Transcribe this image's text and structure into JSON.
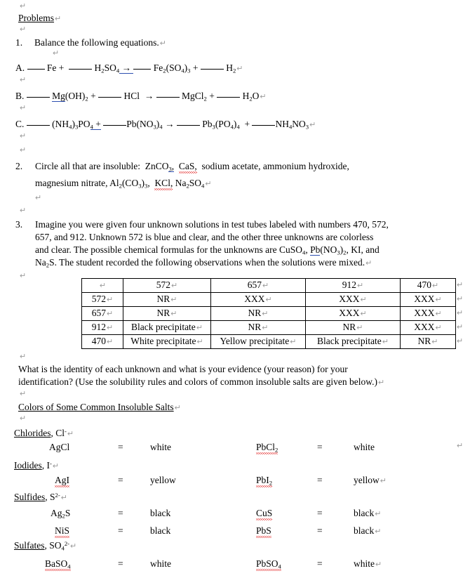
{
  "document": {
    "heading": "Problems",
    "pilcrow_glyph": "↵"
  },
  "q1": {
    "number": "1.",
    "prompt": "Balance the following equations.",
    "equations": [
      {
        "label": "A.",
        "parts": {
          "r1": "Fe",
          "plus1": "+",
          "r2_pre": "H",
          "r2": "H2SO4",
          "arrow": "→",
          "p1": "Fe2(SO4)3",
          "plus2": "+",
          "p2": "H2"
        }
      },
      {
        "label": "B.",
        "parts": {
          "r1": "Mg(OH)2",
          "plus1": "+",
          "r2": "HCl",
          "arrow": "→",
          "p1": "MgCl2",
          "plus2": "+",
          "p2": "H2O"
        }
      },
      {
        "label": "C.",
        "parts": {
          "r1": "(NH4)3PO4",
          "plus1": "+",
          "r2": "Pb(NO3)4",
          "arrow": "→",
          "p1": "Pb3(PO4)4",
          "plus2": "+",
          "p2": "NH4NO3"
        }
      }
    ]
  },
  "q2": {
    "number": "2.",
    "line1_lead": "Circle all that are insoluble:",
    "items_line1": [
      "ZnCO3,",
      "CaS,",
      "sodium acetate,",
      "ammonium hydroxide,"
    ],
    "items_line2": [
      "magnesium nitrate,",
      "Al2(CO3)3,",
      "KCl,",
      "Na2SO4"
    ]
  },
  "q3": {
    "number": "3.",
    "line1": "Imagine you were given four unknown solutions in test tubes labeled with numbers 470, 572,",
    "line2": "657, and 912.  Unknown 572 is blue and clear, and the other three unknowns are colorless",
    "line3_a": "and clear.  The possible chemical formulas for the unknowns are CuSO",
    "line3_sub1": "4",
    "line3_b": ", ",
    "line3_pb": "Pb",
    "line3_c": "(NO",
    "line3_sub2": "3",
    "line3_d": ")",
    "line3_sub3": "2",
    "line3_e": ", KI, and",
    "line4_a": "Na",
    "line4_sub": "2",
    "line4_b": "S.  The student recorded the following observations when the solutions were mixed."
  },
  "table": {
    "headers": [
      "",
      "572",
      "657",
      "912",
      "470"
    ],
    "rows": [
      [
        "572",
        "NR",
        "XXX",
        "XXX",
        "XXX"
      ],
      [
        "657",
        "NR",
        "NR",
        "XXX",
        "XXX"
      ],
      [
        "912",
        "Black precipitate",
        "NR",
        "NR",
        "XXX"
      ],
      [
        "470",
        "White precipitate",
        "Yellow precipitate",
        "Black precipitate",
        "NR"
      ]
    ]
  },
  "question_followup": {
    "line1": "What is the identity of each unknown and what is your evidence (your reason) for your",
    "line2": "identification?  (Use the solubility rules and colors of common insoluble salts are given below.)"
  },
  "colors_section": {
    "heading": "Colors of Some Common Insoluble Salts",
    "groups": [
      {
        "name": "Chlorides",
        "ion_base": "Cl",
        "ion_sup": "-",
        "rows": [
          {
            "left_formula": "AgCl",
            "left_eq": "=",
            "left_color": "white",
            "right_formula_base": "PbCl",
            "right_formula_sub": "2",
            "right_eq": "=",
            "right_color": "white"
          }
        ]
      },
      {
        "name": "Iodides",
        "ion_base": "I",
        "ion_sup": "-",
        "rows": [
          {
            "left_formula": "AgI",
            "left_eq": "=",
            "left_color": "yellow",
            "right_formula_base": "PbI",
            "right_formula_sub": "2",
            "right_eq": "=",
            "right_color": "yellow"
          }
        ]
      },
      {
        "name": "Sulfides",
        "ion_base": "S",
        "ion_sup": "2-",
        "rows": [
          {
            "left_formula_base": "Ag",
            "left_formula_sub": "2",
            "left_formula_tail": "S",
            "left_eq": "=",
            "left_color": "black",
            "right_formula_base": "CuS",
            "right_formula_sub": "",
            "right_eq": "=",
            "right_color": "black"
          },
          {
            "left_formula_base": "NiS",
            "left_formula_sub": "",
            "left_formula_tail": "",
            "left_eq": "=",
            "left_color": "black",
            "right_formula_base": "PbS",
            "right_formula_sub": "",
            "right_eq": "=",
            "right_color": "black"
          }
        ]
      },
      {
        "name": "Sulfates",
        "ion_base": "SO",
        "ion_sub": "4",
        "ion_sup": "2-",
        "rows": [
          {
            "left_formula_base": "BaSO",
            "left_formula_sub": "4",
            "left_eq": "=",
            "left_color": "white",
            "right_formula_base": "PbSO",
            "right_formula_sub": "4",
            "right_eq": "=",
            "right_color": "white"
          }
        ]
      }
    ]
  }
}
